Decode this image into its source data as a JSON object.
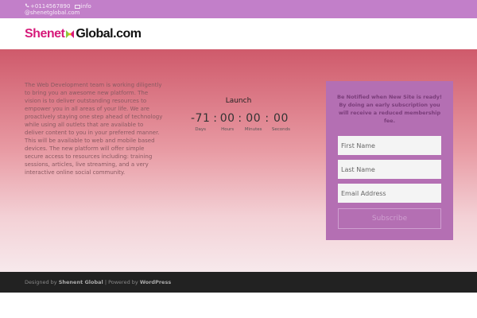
{
  "topbar": {
    "phone": "+0114567890",
    "email_label": "info",
    "email_domain": "@shenetglobal.com"
  },
  "logo": {
    "part1": "Shenet",
    "part2": "Global.com"
  },
  "about": {
    "text": "The Web Development team is working diligently to bring you an awesome new platform. The vision is to deliver outstanding resources to empower you in all areas of your life.  We are proactively staying one step ahead of technology while using all outlets that are available to deliver content to you in your preferred manner.  This will be available to web and mobile based devices.  The new platform will offer simple secure access to resources including: training sessions, articles, live streaming, and a very interactive online social community."
  },
  "countdown": {
    "title": "Launch",
    "days": "-71",
    "hours": "00",
    "minutes": "00",
    "seconds": "00",
    "sep": ":",
    "labels": {
      "days": "Days",
      "hours": "Hours",
      "minutes": "Minutes",
      "seconds": "Seconds"
    }
  },
  "signup": {
    "text": "Be Notified when New Site is ready!  By doing an early subscription you will receive a reduced membership fee.",
    "first_name_placeholder": "First Name",
    "last_name_placeholder": "Last Name",
    "email_placeholder": "Email Address",
    "subscribe_label": "Subscribe"
  },
  "footer": {
    "designed_by": "Designed by",
    "designer": "Shenent Global",
    "separator": "| Powered by",
    "platform": "WordPress"
  },
  "colors": {
    "topbar": "#c27fc9",
    "signup_panel": "#b46fb3",
    "footer": "#222222",
    "logo_accent": "#d61a7a"
  }
}
